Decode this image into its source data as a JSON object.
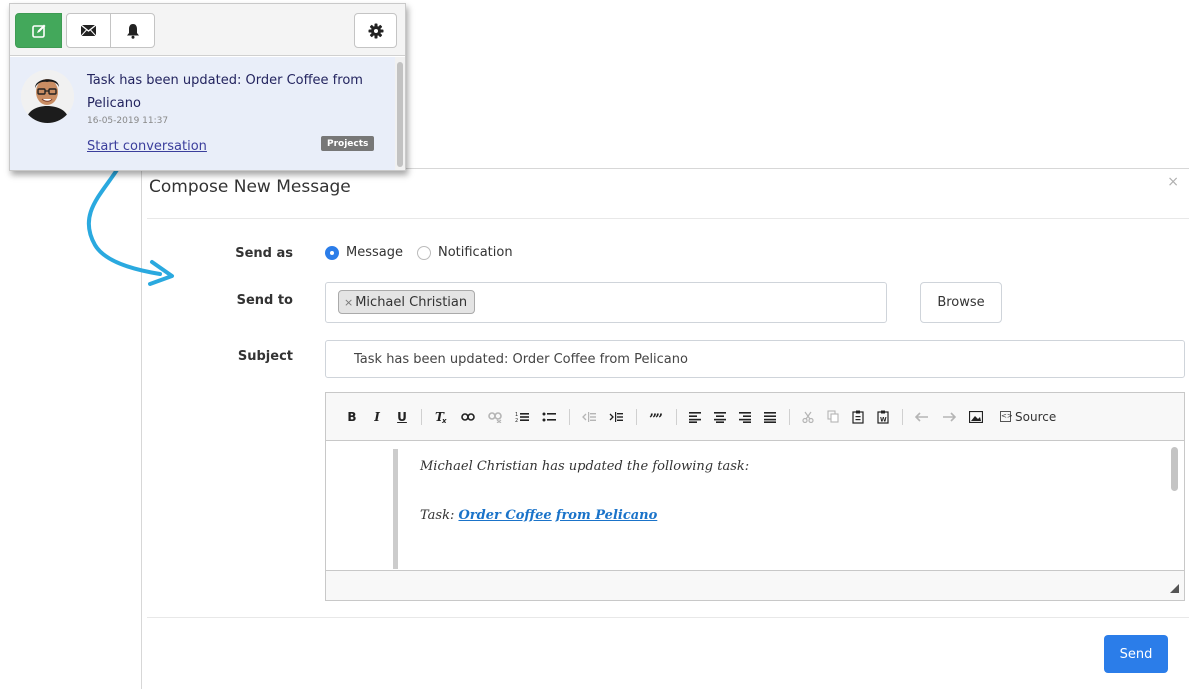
{
  "popup": {
    "toolbar": {
      "compose_icon": "compose-icon",
      "mail_icon": "envelope-icon",
      "bell_icon": "bell-icon",
      "settings_icon": "gear-icon"
    },
    "notification": {
      "title": "Task has been updated: Order Coffee from Pelicano",
      "timestamp": "16-05-2019 11:37",
      "link": "Start conversation",
      "badge": "Projects"
    }
  },
  "modal": {
    "title": "Compose New Message",
    "close": "×",
    "send_as": {
      "label": "Send as",
      "options": [
        "Message",
        "Notification"
      ],
      "selected": "Message"
    },
    "send_to": {
      "label": "Send to",
      "recipients": [
        "Michael Christian"
      ],
      "remove_glyph": "×",
      "browse": "Browse"
    },
    "subject": {
      "label": "Subject",
      "value": "Task has been updated: Order Coffee from Pelicano"
    },
    "editor": {
      "toolbar": {
        "bold": "B",
        "italic": "I",
        "underline": "U",
        "remove_format": "Tx",
        "link": "⚭",
        "unlink": "⚭",
        "numbered_list": "⅓≡",
        "bulleted_list": "•≡",
        "outdent": "⇤",
        "indent": "⇥",
        "blockquote": "99",
        "source": "Source"
      },
      "body": {
        "line1": "Michael Christian has updated the following task:",
        "task_prefix": "Task:",
        "task_link_1": "Order Coffee",
        "task_link_2": "from Pelicano"
      }
    },
    "send_button": "Send"
  },
  "colors": {
    "accent": "#2b7de9",
    "compose_green": "#43a85b",
    "arrow": "#2aa9df",
    "notification_bg": "#e9eef9",
    "badge": "#777777"
  }
}
